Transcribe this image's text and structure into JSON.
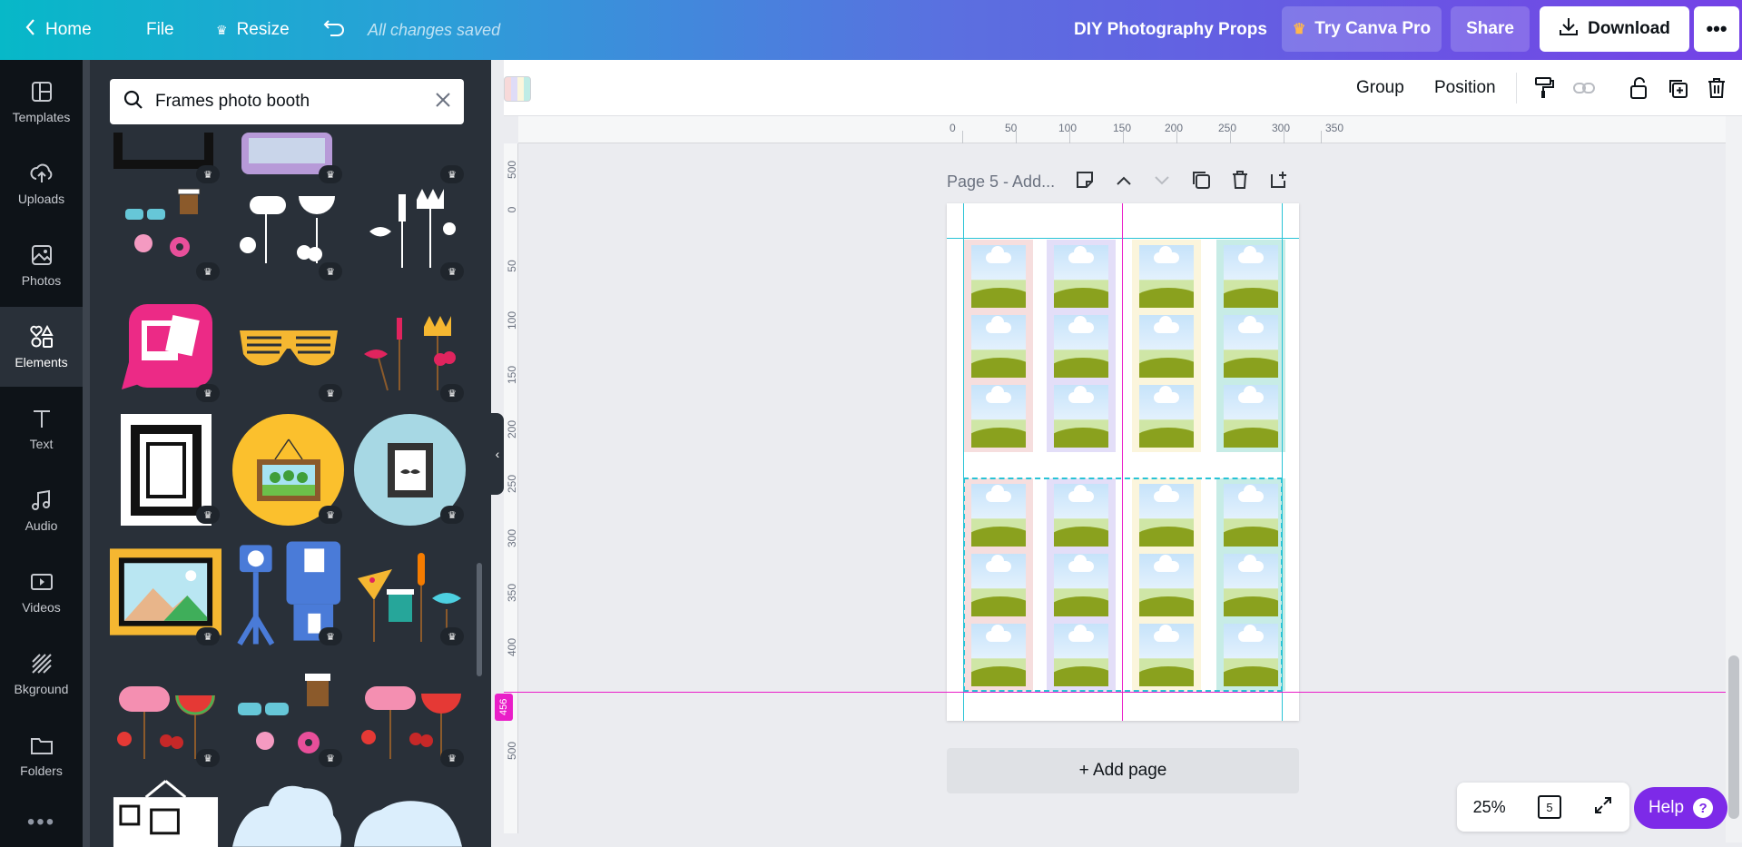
{
  "topbar": {
    "home_label": "Home",
    "file_label": "File",
    "resize_label": "Resize",
    "saved_status": "All changes saved",
    "doc_title": "DIY Photography Props",
    "try_pro_label": "Try Canva Pro",
    "share_label": "Share",
    "download_label": "Download"
  },
  "rail": {
    "items": [
      {
        "label": "Templates"
      },
      {
        "label": "Uploads"
      },
      {
        "label": "Photos"
      },
      {
        "label": "Elements"
      },
      {
        "label": "Text"
      },
      {
        "label": "Audio"
      },
      {
        "label": "Videos"
      },
      {
        "label": "Bkground"
      },
      {
        "label": "Folders"
      }
    ],
    "active": "Elements",
    "more_label": "•••"
  },
  "panel": {
    "search_value": "Frames photo booth",
    "pro_badge": "♛"
  },
  "context_toolbar": {
    "group_label": "Group",
    "position_label": "Position"
  },
  "rulers": {
    "horizontal": [
      "0",
      "50",
      "100",
      "150",
      "200",
      "250",
      "300",
      "350"
    ],
    "vertical": [
      "500",
      "0",
      "50",
      "100",
      "150",
      "200",
      "250",
      "300",
      "350",
      "400",
      "456",
      "500"
    ]
  },
  "page": {
    "header_label": "Page 5 - Add...",
    "add_page_label": "+ Add page"
  },
  "strip_colors": [
    "#f6dede",
    "#e3def8",
    "#fbf5dc",
    "#c7ece6"
  ],
  "zoom": {
    "level": "25%",
    "page_count": "5"
  },
  "help_label": "Help",
  "help_q": "?"
}
